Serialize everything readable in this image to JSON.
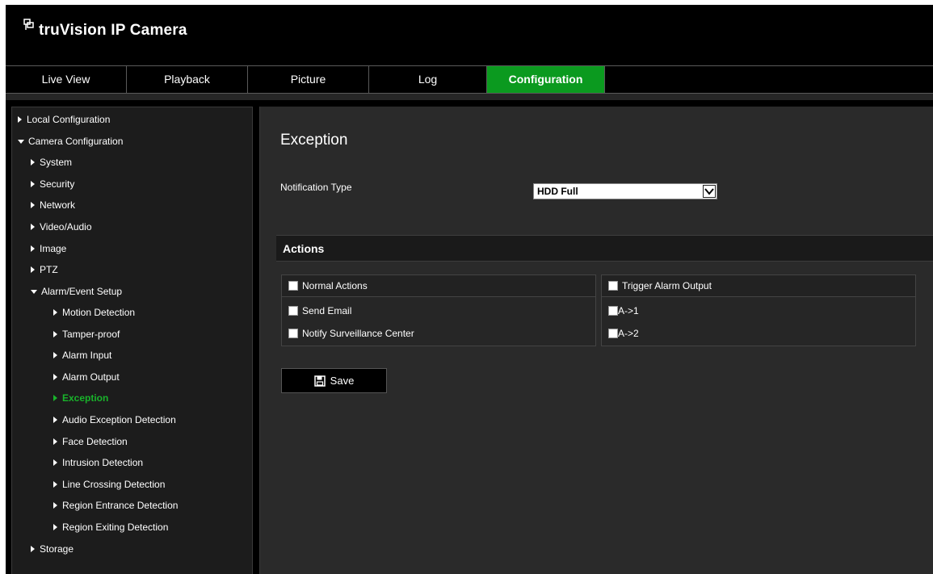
{
  "brand": {
    "name": "truVision  IP Camera"
  },
  "nav": {
    "items": [
      {
        "label": "Live View",
        "active": false
      },
      {
        "label": "Playback",
        "active": false
      },
      {
        "label": "Picture",
        "active": false
      },
      {
        "label": "Log",
        "active": false
      },
      {
        "label": "Configuration",
        "active": true
      }
    ]
  },
  "sidebar": {
    "items": [
      {
        "label": "Local Configuration",
        "expanded": false
      },
      {
        "label": "Camera Configuration",
        "expanded": true
      },
      {
        "label": "System",
        "expanded": false
      },
      {
        "label": "Security",
        "expanded": false
      },
      {
        "label": "Network",
        "expanded": false
      },
      {
        "label": "Video/Audio",
        "expanded": false
      },
      {
        "label": "Image",
        "expanded": false
      },
      {
        "label": "PTZ",
        "expanded": false
      },
      {
        "label": "Alarm/Event Setup",
        "expanded": true
      },
      {
        "label": "Motion Detection",
        "expanded": false
      },
      {
        "label": "Tamper-proof",
        "expanded": false
      },
      {
        "label": "Alarm Input",
        "expanded": false
      },
      {
        "label": "Alarm Output",
        "expanded": false
      },
      {
        "label": "Exception",
        "expanded": false,
        "selected": true
      },
      {
        "label": "Audio Exception Detection",
        "expanded": false
      },
      {
        "label": "Face Detection",
        "expanded": false
      },
      {
        "label": "Intrusion Detection",
        "expanded": false
      },
      {
        "label": "Line Crossing Detection",
        "expanded": false
      },
      {
        "label": "Region Entrance Detection",
        "expanded": false
      },
      {
        "label": "Region Exiting Detection",
        "expanded": false
      },
      {
        "label": "Storage",
        "expanded": false
      }
    ]
  },
  "main": {
    "title": "Exception",
    "notification_label": "Notification Type",
    "notification_value": "HDD Full",
    "actions_title": "Actions",
    "normal_actions": {
      "header": "Normal Actions",
      "items": [
        "Send Email",
        "Notify Surveillance Center"
      ]
    },
    "alarm_output": {
      "header": "Trigger Alarm Output",
      "items": [
        "A->1",
        "A->2"
      ]
    },
    "save_label": "Save"
  },
  "colors": {
    "accent": "#0b9a1f",
    "selected_text": "#19b32b",
    "background": "#000000",
    "content_bg": "#2a2a2a"
  },
  "icons": {
    "brand": "network-logo-icon",
    "save": "floppy-disk-icon",
    "dropdown": "chevron-down-icon",
    "tree_collapsed": "caret-right-icon",
    "tree_expanded": "caret-down-icon"
  }
}
